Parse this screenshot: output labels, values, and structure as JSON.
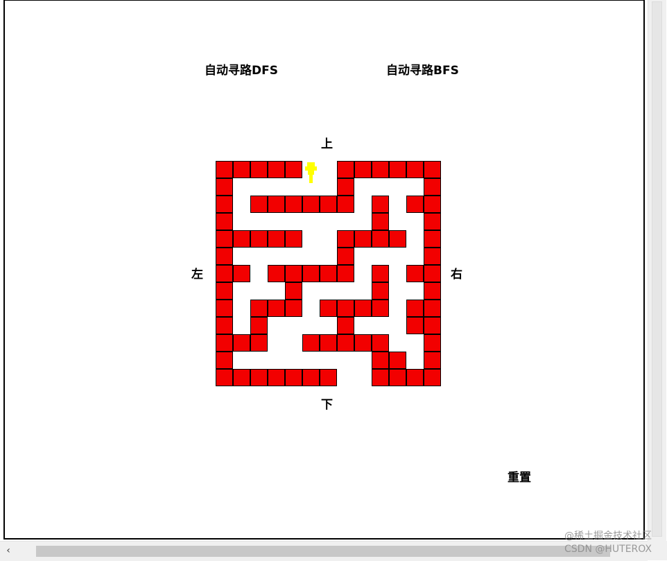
{
  "buttons": {
    "dfs_label": "自动寻路DFS",
    "bfs_label": "自动寻路BFS",
    "up_label": "上",
    "down_label": "下",
    "left_label": "左",
    "right_label": "右",
    "reset_label": "重置"
  },
  "maze": {
    "columns": 13,
    "rows": 13,
    "wall_color": "#f20000",
    "player_color": "#ffff00",
    "grid": [
      "1111100111111",
      "1000000100001",
      "1011111101011",
      "1000000001001",
      "1111100111101",
      "1000000100001",
      "1101111101011",
      "1000100001001",
      "1011101111011",
      "1010000100011",
      "1110011111001",
      "1000000001101",
      "1111111001111"
    ],
    "player": {
      "row": 0,
      "col": 5
    }
  },
  "watermark": {
    "line1": "@稀土掘金技术社区",
    "line2": "CSDN @HUTEROX"
  },
  "scrollbar": {
    "left_arrow": "‹"
  }
}
